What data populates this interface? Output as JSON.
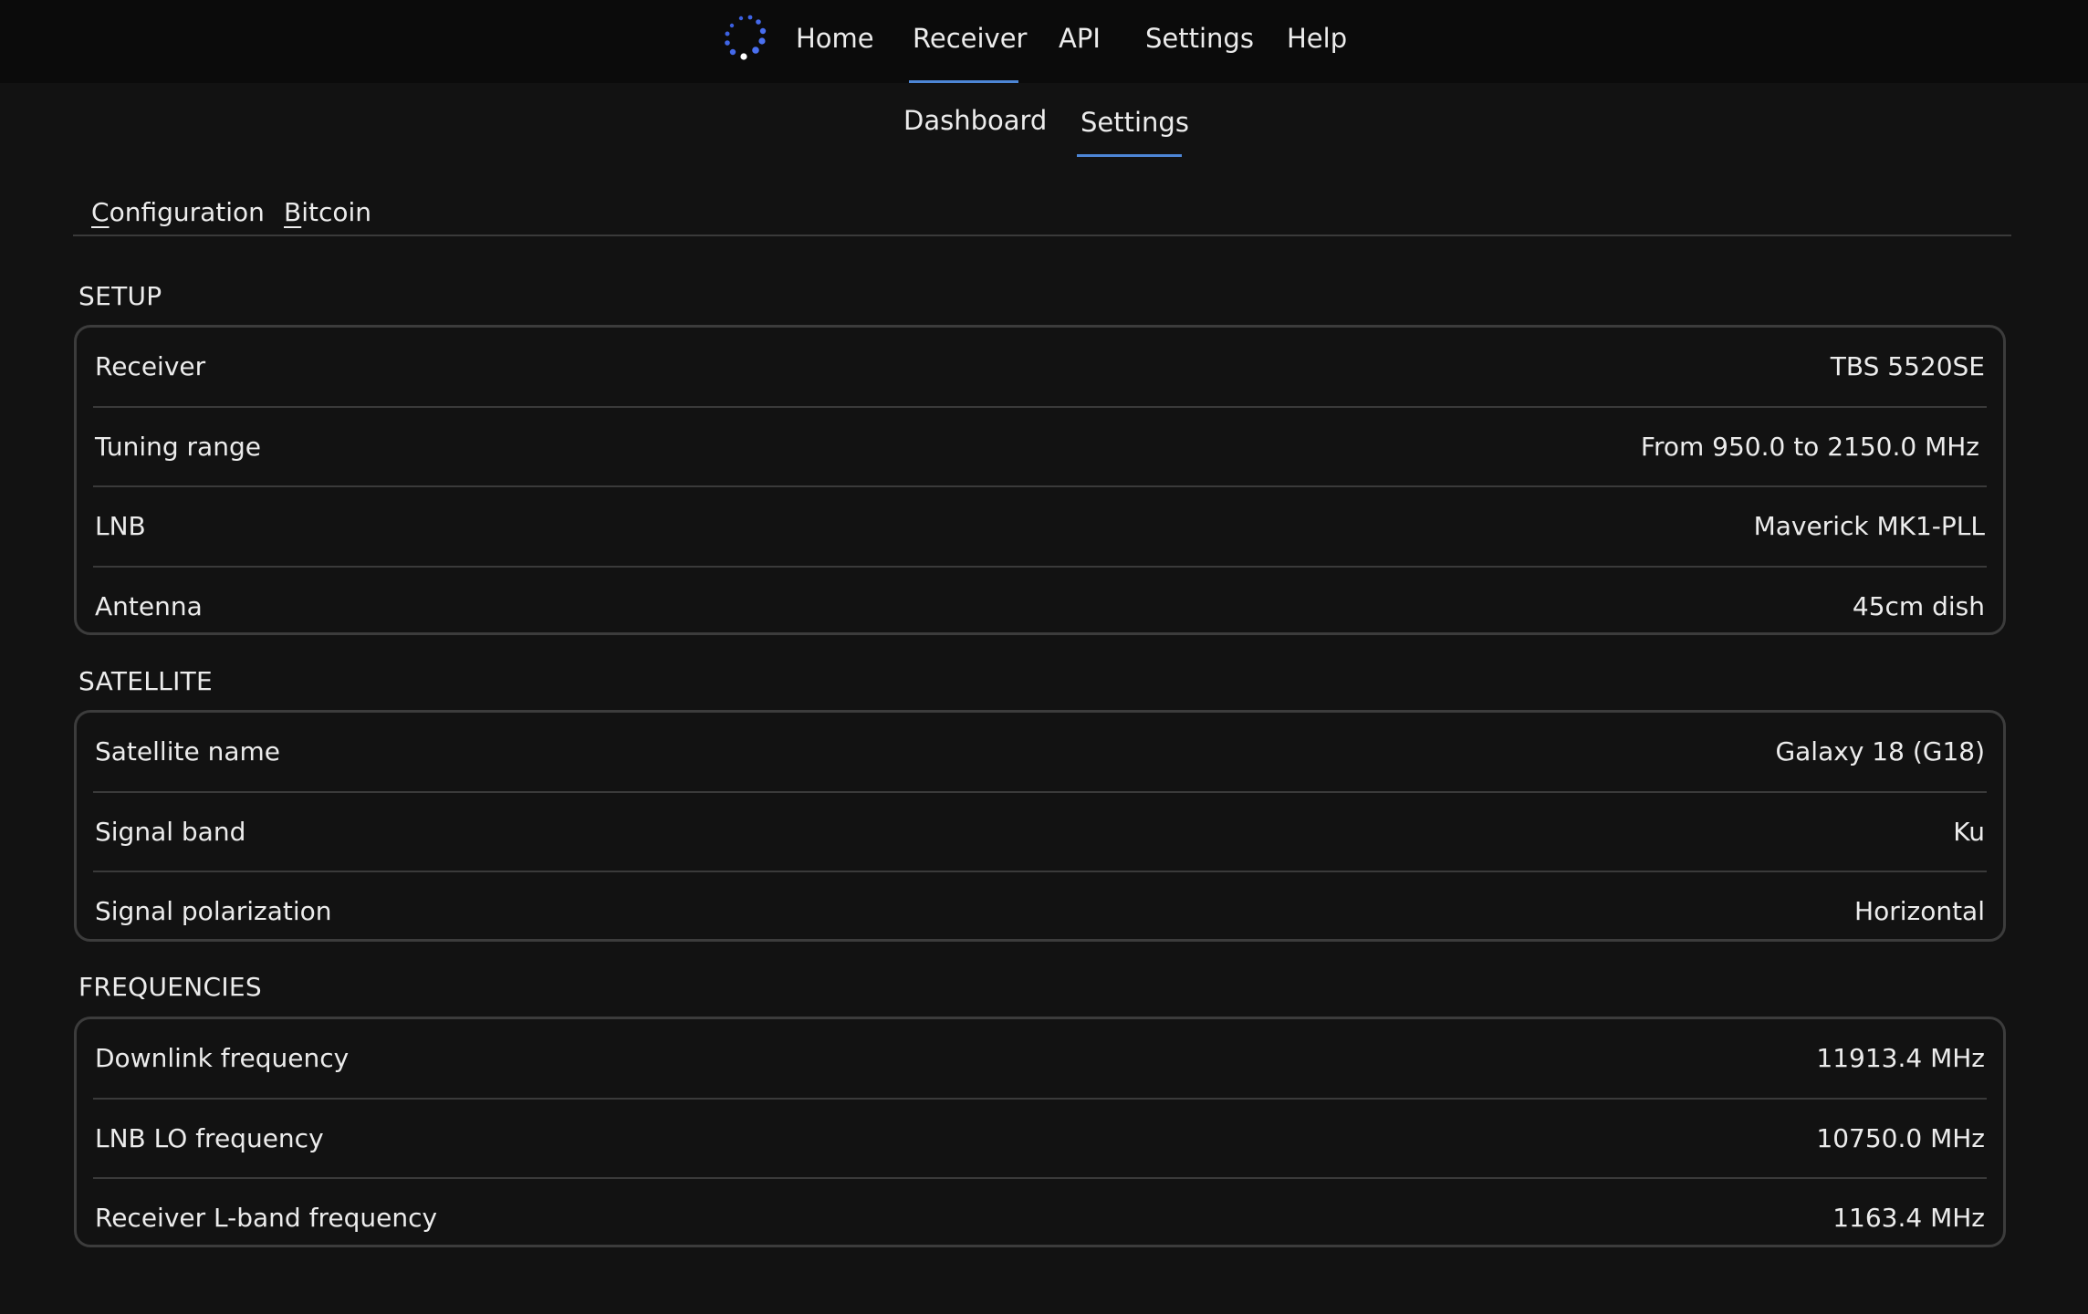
{
  "header": {
    "logo_icon": "spinner-dots-logo",
    "nav": [
      {
        "label": "Home",
        "active": false
      },
      {
        "label": "Receiver",
        "active": true
      },
      {
        "label": "API",
        "active": false
      },
      {
        "label": "Settings",
        "active": false
      },
      {
        "label": "Help",
        "active": false
      }
    ],
    "accent_color": "#4d86d6"
  },
  "subnav": [
    {
      "label": "Dashboard",
      "active": false
    },
    {
      "label": "Settings",
      "active": true
    }
  ],
  "tabs": [
    {
      "mnemonic": "C",
      "rest": "onfiguration",
      "label": "Configuration"
    },
    {
      "mnemonic": "B",
      "rest": "itcoin",
      "label": "Bitcoin"
    }
  ],
  "sections": [
    {
      "title": "SETUP",
      "rows": [
        {
          "label": "Receiver",
          "value": "TBS 5520SE"
        },
        {
          "label": "Tuning range",
          "value": "From 950.0 to 2150.0 MHz"
        },
        {
          "label": "LNB",
          "value": "Maverick MK1-PLL"
        },
        {
          "label": "Antenna",
          "value": "45cm dish"
        }
      ]
    },
    {
      "title": "SATELLITE",
      "rows": [
        {
          "label": "Satellite name",
          "value": "Galaxy 18 (G18)"
        },
        {
          "label": "Signal band",
          "value": "Ku"
        },
        {
          "label": "Signal polarization",
          "value": "Horizontal"
        }
      ]
    },
    {
      "title": "FREQUENCIES",
      "rows": [
        {
          "label": "Downlink frequency",
          "value": "11913.4 MHz"
        },
        {
          "label": "LNB LO frequency",
          "value": "10750.0 MHz"
        },
        {
          "label": "Receiver L-band frequency",
          "value": "1163.4 MHz"
        }
      ]
    }
  ]
}
